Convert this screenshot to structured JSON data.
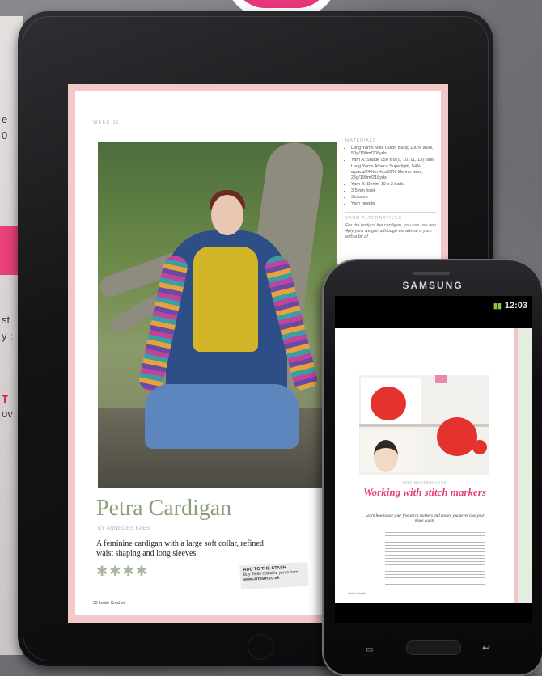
{
  "background": {
    "left_fragments": [
      "e",
      "0",
      "st",
      "y :",
      "T",
      "ov"
    ]
  },
  "tablet_page": {
    "running_head": "WEEK 11",
    "materials": {
      "heading": "MATERIALS",
      "items": [
        "Lang Yarns Mille Colori Baby, 100% wool, 50g/190m/208yds",
        "Yarn A: Shade 050 x 8 (9, 10, 11, 13) balls",
        "Lang Yarns Alpaca Superlight, 54% alpaca/24% nylon/22% Merino wool, 25g/199m/218yds",
        "Yarn B: Denim 10 x 2 balls",
        "3.5mm hook",
        "Scissors",
        "Yarn needle"
      ],
      "alt_heading": "YARN ALTERNATIVES",
      "alt_text": "For the body of the cardigan, you can use any 4ply yarn weight, although we advise a yarn with a bit of"
    },
    "title": "Petra Cardigan",
    "byline": "BY ANNELIES BAES",
    "description": "A feminine cardigan with a large soft collar, refined waist shaping and long sleeves.",
    "rating_stars": "✱✱✱✱",
    "stash": {
      "heading": "ADD TO THE STASH",
      "text": "Buy these colourful yarns from",
      "url": "www.artyarn.co.uk"
    },
    "folio": "30 Inside Crochet"
  },
  "phone": {
    "brand": "SAMSUNG",
    "status_time": "12:03",
    "page": {
      "section": "MINI MASTERCLASS",
      "title": "Working with stitch markers",
      "subtitle": "Learn how to use your free stitch markers and ensure you never lose your place again.",
      "folio": "Inside Crochet"
    }
  },
  "icons": {
    "menu": "menu-icon",
    "back": "back-icon"
  }
}
